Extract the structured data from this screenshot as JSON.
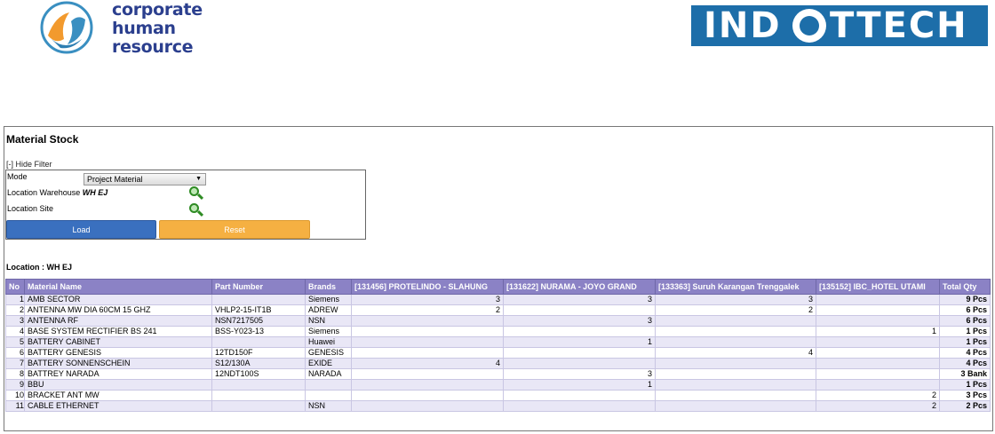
{
  "header": {
    "left_logo_lines": [
      "corporate",
      "human",
      "resource"
    ],
    "right_logo_text_a": "IND",
    "right_logo_text_b": "TTECH"
  },
  "panel": {
    "title": "Material Stock",
    "hide_filter": "[-] Hide Filter",
    "filter": {
      "mode_label": "Mode",
      "mode_value": "Project Material",
      "warehouse_label": "Location Warehouse",
      "warehouse_value": "WH EJ",
      "site_label": "Location Site",
      "load_label": "Load",
      "reset_label": "Reset"
    },
    "location_line": "Location : WH EJ"
  },
  "table": {
    "headers": [
      "No",
      "Material Name",
      "Part Number",
      "Brands",
      "[131456] PROTELINDO - SLAHUNG",
      "[131622] NURAMA - JOYO GRAND",
      "[133363] Suruh Karangan Trenggalek",
      "[135152] IBC_HOTEL UTAMI",
      "Total Qty"
    ],
    "rows": [
      {
        "no": "1",
        "name": "AMB SECTOR",
        "part": "",
        "brand": "Siemens",
        "c1": "3",
        "c2": "3",
        "c3": "3",
        "c4": "",
        "total": "9 Pcs"
      },
      {
        "no": "2",
        "name": "ANTENNA MW DIA 60CM 15 GHZ",
        "part": "VHLP2-15-IT1B",
        "brand": "ADREW",
        "c1": "2",
        "c2": "",
        "c3": "2",
        "c4": "",
        "total": "6 Pcs"
      },
      {
        "no": "3",
        "name": "ANTENNA RF",
        "part": "NSN7217505",
        "brand": "NSN",
        "c1": "",
        "c2": "3",
        "c3": "",
        "c4": "",
        "total": "6 Pcs"
      },
      {
        "no": "4",
        "name": "BASE SYSTEM RECTIFIER BS 241",
        "part": "BSS-Y023-13",
        "brand": "Siemens",
        "c1": "",
        "c2": "",
        "c3": "",
        "c4": "1",
        "total": "1 Pcs"
      },
      {
        "no": "5",
        "name": "BATTERY CABINET",
        "part": "",
        "brand": "Huawei",
        "c1": "",
        "c2": "1",
        "c3": "",
        "c4": "",
        "total": "1 Pcs"
      },
      {
        "no": "6",
        "name": "BATTERY GENESIS",
        "part": "12TD150F",
        "brand": "GENESIS",
        "c1": "",
        "c2": "",
        "c3": "4",
        "c4": "",
        "total": "4 Pcs"
      },
      {
        "no": "7",
        "name": "BATTERY SONNENSCHEIN",
        "part": "S12/130A",
        "brand": "EXIDE",
        "c1": "4",
        "c2": "",
        "c3": "",
        "c4": "",
        "total": "4 Pcs"
      },
      {
        "no": "8",
        "name": "BATTREY NARADA",
        "part": "12NDT100S",
        "brand": "NARADA",
        "c1": "",
        "c2": "3",
        "c3": "",
        "c4": "",
        "total": "3 Bank"
      },
      {
        "no": "9",
        "name": "BBU",
        "part": "",
        "brand": "",
        "c1": "",
        "c2": "1",
        "c3": "",
        "c4": "",
        "total": "1 Pcs"
      },
      {
        "no": "10",
        "name": "BRACKET ANT MW",
        "part": "",
        "brand": "",
        "c1": "",
        "c2": "",
        "c3": "",
        "c4": "2",
        "total": "3 Pcs"
      },
      {
        "no": "11",
        "name": "CABLE ETHERNET",
        "part": "",
        "brand": "NSN",
        "c1": "",
        "c2": "",
        "c3": "",
        "c4": "2",
        "total": "2 Pcs"
      }
    ]
  },
  "colors": {
    "header_bg": "#8b82c5",
    "row_alt": "#e9e7f6",
    "load_btn": "#3a70bf",
    "reset_btn": "#f5b042"
  }
}
